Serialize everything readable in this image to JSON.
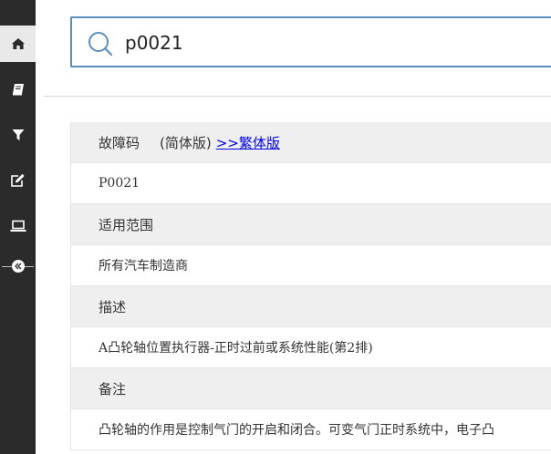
{
  "sidebar": {
    "items": [
      {
        "icon": "home-icon",
        "active": true
      },
      {
        "icon": "book-icon",
        "active": false
      },
      {
        "icon": "filter-icon",
        "active": false
      },
      {
        "icon": "edit-icon",
        "active": false
      },
      {
        "icon": "laptop-icon",
        "active": false
      },
      {
        "icon": "collapse-icon",
        "active": false
      }
    ]
  },
  "search": {
    "value": "p0021"
  },
  "result": {
    "code_header": "故障码",
    "edition_label": "(简体版)",
    "traditional_link": ">>繁体版",
    "code_value": "P0021",
    "scope_header": "适用范围",
    "scope_value": "所有汽车制造商",
    "desc_header": "描述",
    "desc_value": "A凸轮轴位置执行器-正时过前或系统性能(第2排)",
    "notes_header": "备注",
    "notes_value": "凸轮轴的作用是控制气门的开启和闭合。可变气门正时系统中，电子凸"
  },
  "colors": {
    "sidebar_bg": "#2b2b2b",
    "search_border": "#5a8fbf",
    "header_row_bg": "#efefef",
    "link": "#0000ee"
  }
}
